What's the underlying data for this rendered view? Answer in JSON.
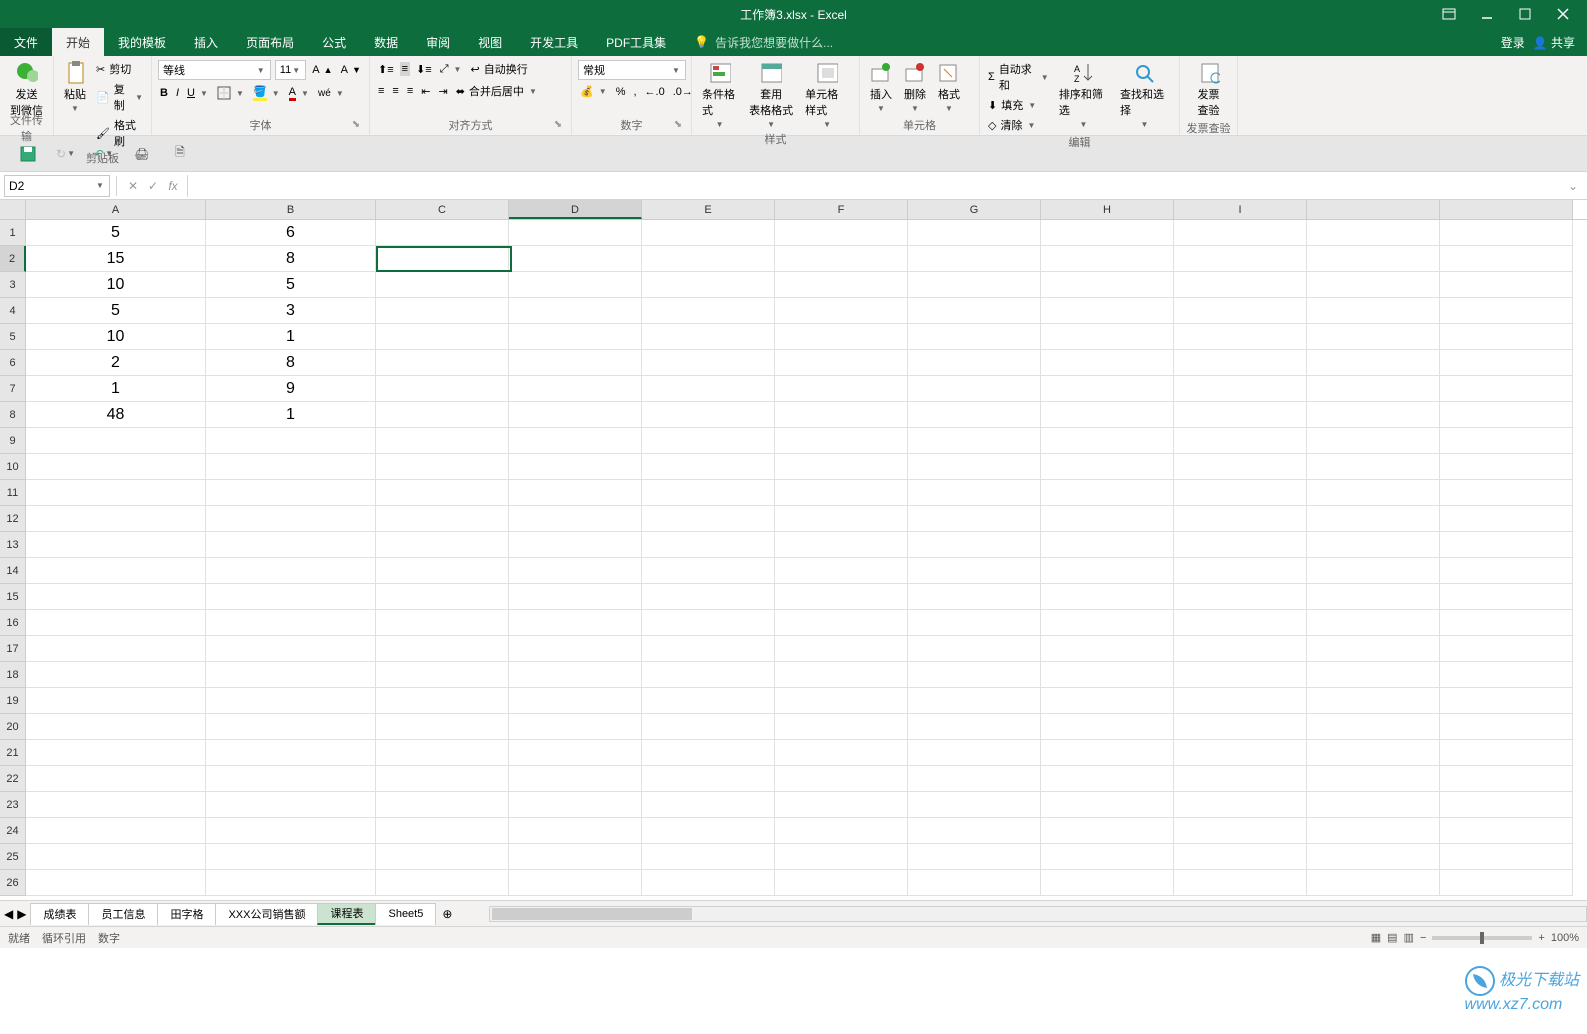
{
  "title": "工作簿3.xlsx - Excel",
  "window": {
    "login": "登录",
    "share": "共享"
  },
  "menu": {
    "file": "文件",
    "home": "开始",
    "templates": "我的模板",
    "insert": "插入",
    "layout": "页面布局",
    "formulas": "公式",
    "data": "数据",
    "review": "审阅",
    "view": "视图",
    "dev": "开发工具",
    "pdf": "PDF工具集",
    "hint": "告诉我您想要做什么..."
  },
  "ribbon": {
    "send": "发送\n到微信",
    "filetransfer": "文件传输",
    "paste": "粘贴",
    "cut": "剪切",
    "copy": "复制",
    "painter": "格式刷",
    "clipboard": "剪贴板",
    "font_name": "等线",
    "font_size": "11",
    "font_group": "字体",
    "wrap": "自动换行",
    "merge": "合并后居中",
    "align_group": "对齐方式",
    "num_format": "常规",
    "num_group": "数字",
    "cond": "条件格式",
    "table": "套用\n表格格式",
    "cellstyle": "单元格样式",
    "style_group": "样式",
    "insert_btn": "插入",
    "delete_btn": "删除",
    "format_btn": "格式",
    "cell_group": "单元格",
    "autosum": "自动求和",
    "fill": "填充",
    "clear": "清除",
    "sort": "排序和筛选",
    "find": "查找和选择",
    "edit_group": "编辑",
    "invoice": "发票\n查验",
    "invoice_group": "发票查验"
  },
  "namebox": "D2",
  "columns": [
    "A",
    "B",
    "C",
    "D",
    "E",
    "F",
    "G",
    "H",
    "I"
  ],
  "rows": [
    "1",
    "2",
    "3",
    "4",
    "5",
    "6",
    "7",
    "8",
    "9",
    "10",
    "11",
    "12",
    "13",
    "14",
    "15",
    "16",
    "17",
    "18",
    "19",
    "20",
    "21",
    "22",
    "23",
    "24",
    "25",
    "26"
  ],
  "cells": {
    "A": [
      "5",
      "15",
      "10",
      "5",
      "10",
      "2",
      "1",
      "48"
    ],
    "B": [
      "6",
      "8",
      "5",
      "3",
      "1",
      "8",
      "9",
      "1"
    ]
  },
  "sheets": [
    "成绩表",
    "员工信息",
    "田字格",
    "XXX公司销售额",
    "课程表",
    "Sheet5"
  ],
  "active_sheet": 4,
  "status": {
    "ready": "就绪",
    "circular": "循环引用",
    "numlock": "数字",
    "zoom": "100%"
  },
  "watermark": "极光下载站\nwww.xz7.com"
}
